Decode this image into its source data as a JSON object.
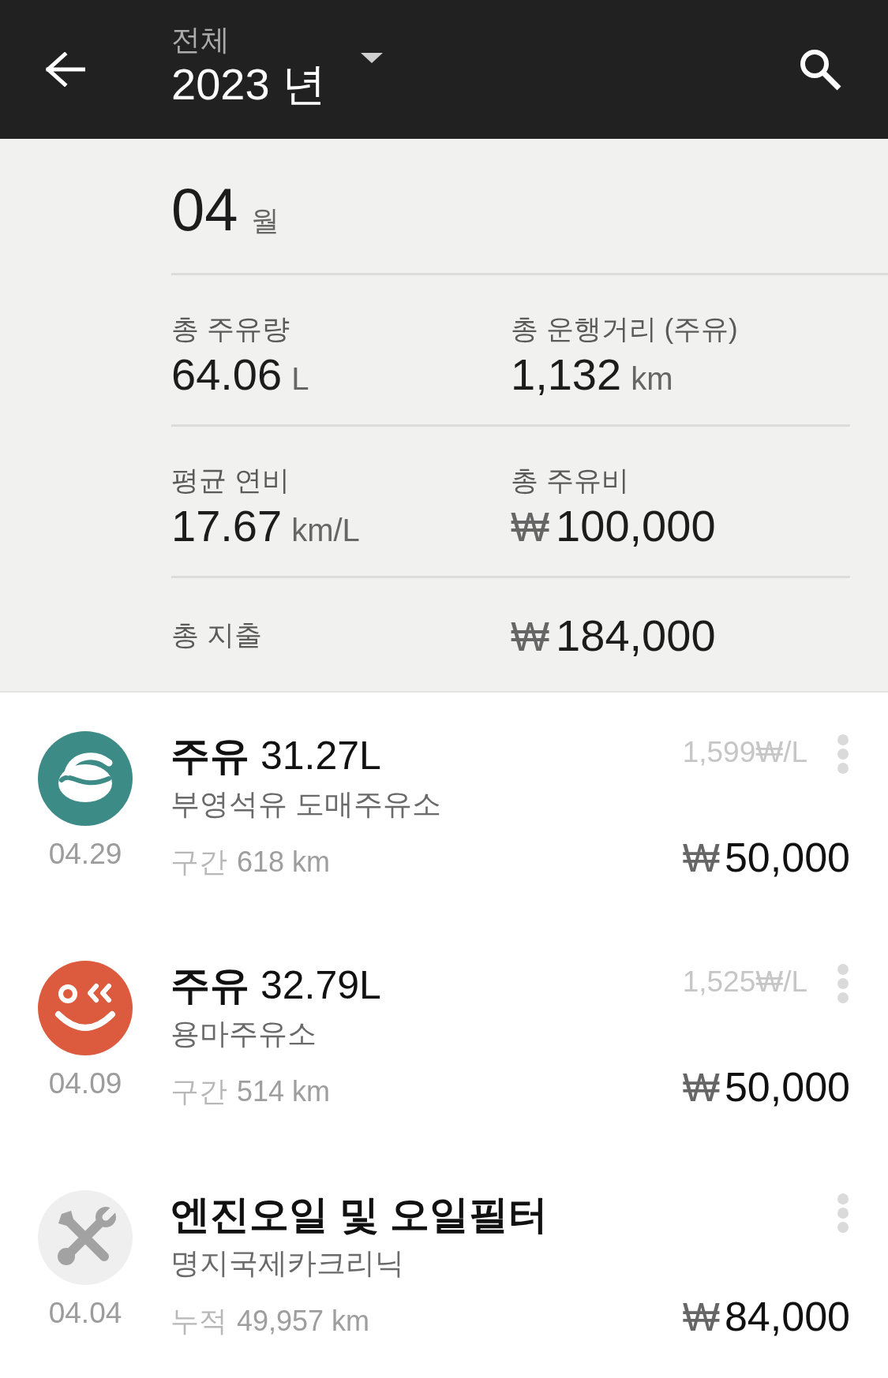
{
  "header": {
    "filter": "전체",
    "year": "2023 년"
  },
  "month": {
    "number": "04",
    "unit": "월"
  },
  "stats": [
    {
      "label": "총 주유량",
      "value": "64.06",
      "unit": "L"
    },
    {
      "label": "총 운행거리 (주유)",
      "value": "1,132",
      "unit": "km"
    },
    {
      "label": "평균 연비",
      "value": "17.67",
      "unit": "km/L"
    },
    {
      "label": "총 주유비",
      "currency": "₩",
      "value": "100,000"
    }
  ],
  "total": {
    "label": "총 지출",
    "currency": "₩",
    "value": "184,000"
  },
  "records": [
    {
      "logo": {
        "kind": "swirl",
        "color": "#3d8b87"
      },
      "date": "04.29",
      "title": "주유",
      "volume": "31.27L",
      "place": "부영석유 도매주유소",
      "unit_price": "1,599₩/L",
      "distance_label": "구간",
      "distance": "618 km",
      "currency": "₩",
      "amount": "50,000"
    },
    {
      "logo": {
        "kind": "smile",
        "color": "#dc5a3e"
      },
      "date": "04.09",
      "title": "주유",
      "volume": "32.79L",
      "place": "용마주유소",
      "unit_price": "1,525₩/L",
      "distance_label": "구간",
      "distance": "514 km",
      "currency": "₩",
      "amount": "50,000"
    },
    {
      "logo": {
        "kind": "tools",
        "color": "#efefef"
      },
      "date": "04.04",
      "title": "엔진오일 및 오일필터",
      "place": "명지국제카크리닉",
      "distance_label": "누적",
      "distance": "49,957 km",
      "currency": "₩",
      "amount": "84,000"
    }
  ]
}
